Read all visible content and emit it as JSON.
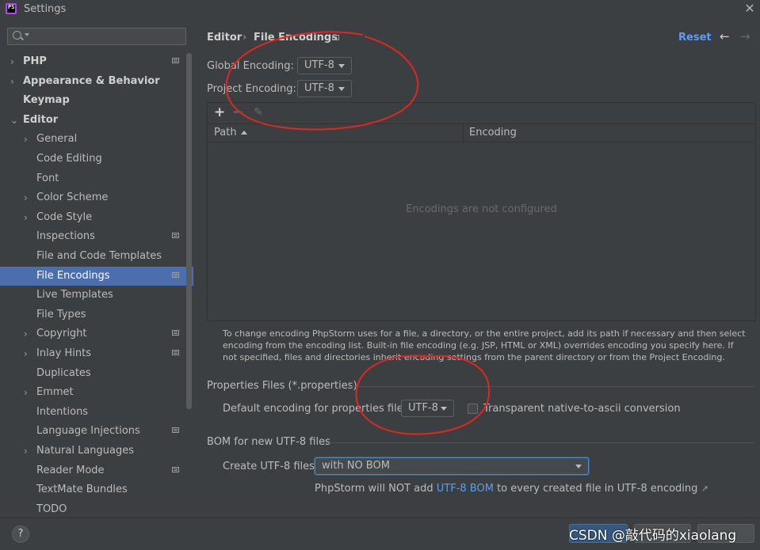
{
  "window": {
    "title": "Settings",
    "app_icon_text": "PS"
  },
  "sidebar": {
    "search_placeholder": "",
    "items": [
      {
        "label": "PHP",
        "chevron": "›",
        "bold": true,
        "indent": 0,
        "has_icon": true
      },
      {
        "label": "Appearance & Behavior",
        "chevron": "›",
        "bold": true,
        "indent": 0,
        "has_icon": false
      },
      {
        "label": "Keymap",
        "chevron": "",
        "bold": true,
        "indent": 0,
        "has_icon": false
      },
      {
        "label": "Editor",
        "chevron": "⌄",
        "bold": true,
        "indent": 0,
        "has_icon": false
      },
      {
        "label": "General",
        "chevron": "›",
        "bold": false,
        "indent": 1,
        "has_icon": false
      },
      {
        "label": "Code Editing",
        "chevron": "",
        "bold": false,
        "indent": 1,
        "has_icon": false
      },
      {
        "label": "Font",
        "chevron": "",
        "bold": false,
        "indent": 1,
        "has_icon": false
      },
      {
        "label": "Color Scheme",
        "chevron": "›",
        "bold": false,
        "indent": 1,
        "has_icon": false
      },
      {
        "label": "Code Style",
        "chevron": "›",
        "bold": false,
        "indent": 1,
        "has_icon": false
      },
      {
        "label": "Inspections",
        "chevron": "",
        "bold": false,
        "indent": 1,
        "has_icon": true
      },
      {
        "label": "File and Code Templates",
        "chevron": "",
        "bold": false,
        "indent": 1,
        "has_icon": false
      },
      {
        "label": "File Encodings",
        "chevron": "",
        "bold": false,
        "indent": 1,
        "has_icon": true,
        "selected": true
      },
      {
        "label": "Live Templates",
        "chevron": "",
        "bold": false,
        "indent": 1,
        "has_icon": false
      },
      {
        "label": "File Types",
        "chevron": "",
        "bold": false,
        "indent": 1,
        "has_icon": false
      },
      {
        "label": "Copyright",
        "chevron": "›",
        "bold": false,
        "indent": 1,
        "has_icon": true
      },
      {
        "label": "Inlay Hints",
        "chevron": "›",
        "bold": false,
        "indent": 1,
        "has_icon": true
      },
      {
        "label": "Duplicates",
        "chevron": "",
        "bold": false,
        "indent": 1,
        "has_icon": false
      },
      {
        "label": "Emmet",
        "chevron": "›",
        "bold": false,
        "indent": 1,
        "has_icon": false
      },
      {
        "label": "Intentions",
        "chevron": "",
        "bold": false,
        "indent": 1,
        "has_icon": false
      },
      {
        "label": "Language Injections",
        "chevron": "",
        "bold": false,
        "indent": 1,
        "has_icon": true
      },
      {
        "label": "Natural Languages",
        "chevron": "›",
        "bold": false,
        "indent": 1,
        "has_icon": false
      },
      {
        "label": "Reader Mode",
        "chevron": "",
        "bold": false,
        "indent": 1,
        "has_icon": true
      },
      {
        "label": "TextMate Bundles",
        "chevron": "",
        "bold": false,
        "indent": 1,
        "has_icon": false
      },
      {
        "label": "TODO",
        "chevron": "",
        "bold": false,
        "indent": 1,
        "has_icon": false
      }
    ]
  },
  "header": {
    "breadcrumb_parent": "Editor",
    "breadcrumb_sep": "›",
    "breadcrumb_current": "File Encodings",
    "reset_label": "Reset",
    "back_icon": "←",
    "forward_icon": "→"
  },
  "encodings": {
    "global_label": "Global Encoding:",
    "global_value": "UTF-8",
    "project_label": "Project Encoding:",
    "project_value": "UTF-8"
  },
  "table": {
    "add_icon": "+",
    "remove_icon": "−",
    "edit_icon": "✎",
    "columns": [
      "Path",
      "Encoding"
    ],
    "empty_text": "Encodings are not configured"
  },
  "help_text": "To change encoding PhpStorm uses for a file, a directory, or the entire project, add its path if necessary and then select encoding from the encoding list. Built-in file encoding (e.g. JSP, HTML or XML) overrides encoding you specify here. If not specified, files and directories inherit encoding settings from the parent directory or from the Project Encoding.",
  "properties": {
    "section_title": "Properties Files (*.properties)",
    "default_label": "Default encoding for properties files:",
    "default_value": "UTF-8",
    "native_label": "Transparent native-to-ascii conversion",
    "native_checked": false
  },
  "bom": {
    "section_title": "BOM for new UTF-8 files",
    "create_label": "Create UTF-8 files:",
    "create_value": "with NO BOM",
    "info_prefix": "PhpStorm will NOT add ",
    "info_link": "UTF-8 BOM",
    "info_suffix": " to every created file in UTF-8 encoding",
    "info_icon": "↗"
  },
  "footer": {
    "help_label": "?",
    "watermark": "CSDN @敲代码的xiaolang"
  },
  "colors": {
    "accent": "#589df6",
    "selection": "#4b6eaf",
    "annotation": "#e0271f",
    "background": "#3c3f41"
  }
}
